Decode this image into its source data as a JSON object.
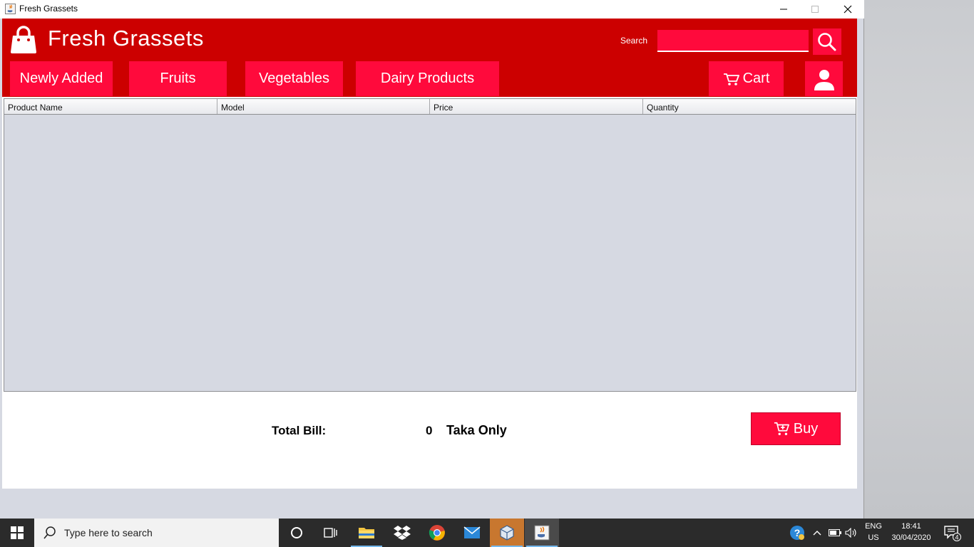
{
  "window": {
    "title": "Fresh Grassets"
  },
  "header": {
    "brand": "Fresh Grassets",
    "search_label": "Search",
    "search_value": "",
    "nav": {
      "newly_added": "Newly Added",
      "fruits": "Fruits",
      "vegetables": "Vegetables",
      "dairy": "Dairy Products",
      "cart": "Cart"
    }
  },
  "table": {
    "columns": [
      "Product Name",
      "Model",
      "Price",
      "Quantity"
    ],
    "rows": []
  },
  "footer": {
    "total_label": "Total Bill:",
    "total_value": "0",
    "total_suffix": "Taka Only",
    "buy_label": "Buy"
  },
  "taskbar": {
    "search_placeholder": "Type here to search",
    "lang_line1": "ENG",
    "lang_line2": "US",
    "time": "18:41",
    "date": "30/04/2020",
    "notification_count": "4"
  },
  "colors": {
    "header_bg": "#cc0000",
    "accent": "#ff0a3c",
    "table_bg": "#d6d9e2"
  }
}
